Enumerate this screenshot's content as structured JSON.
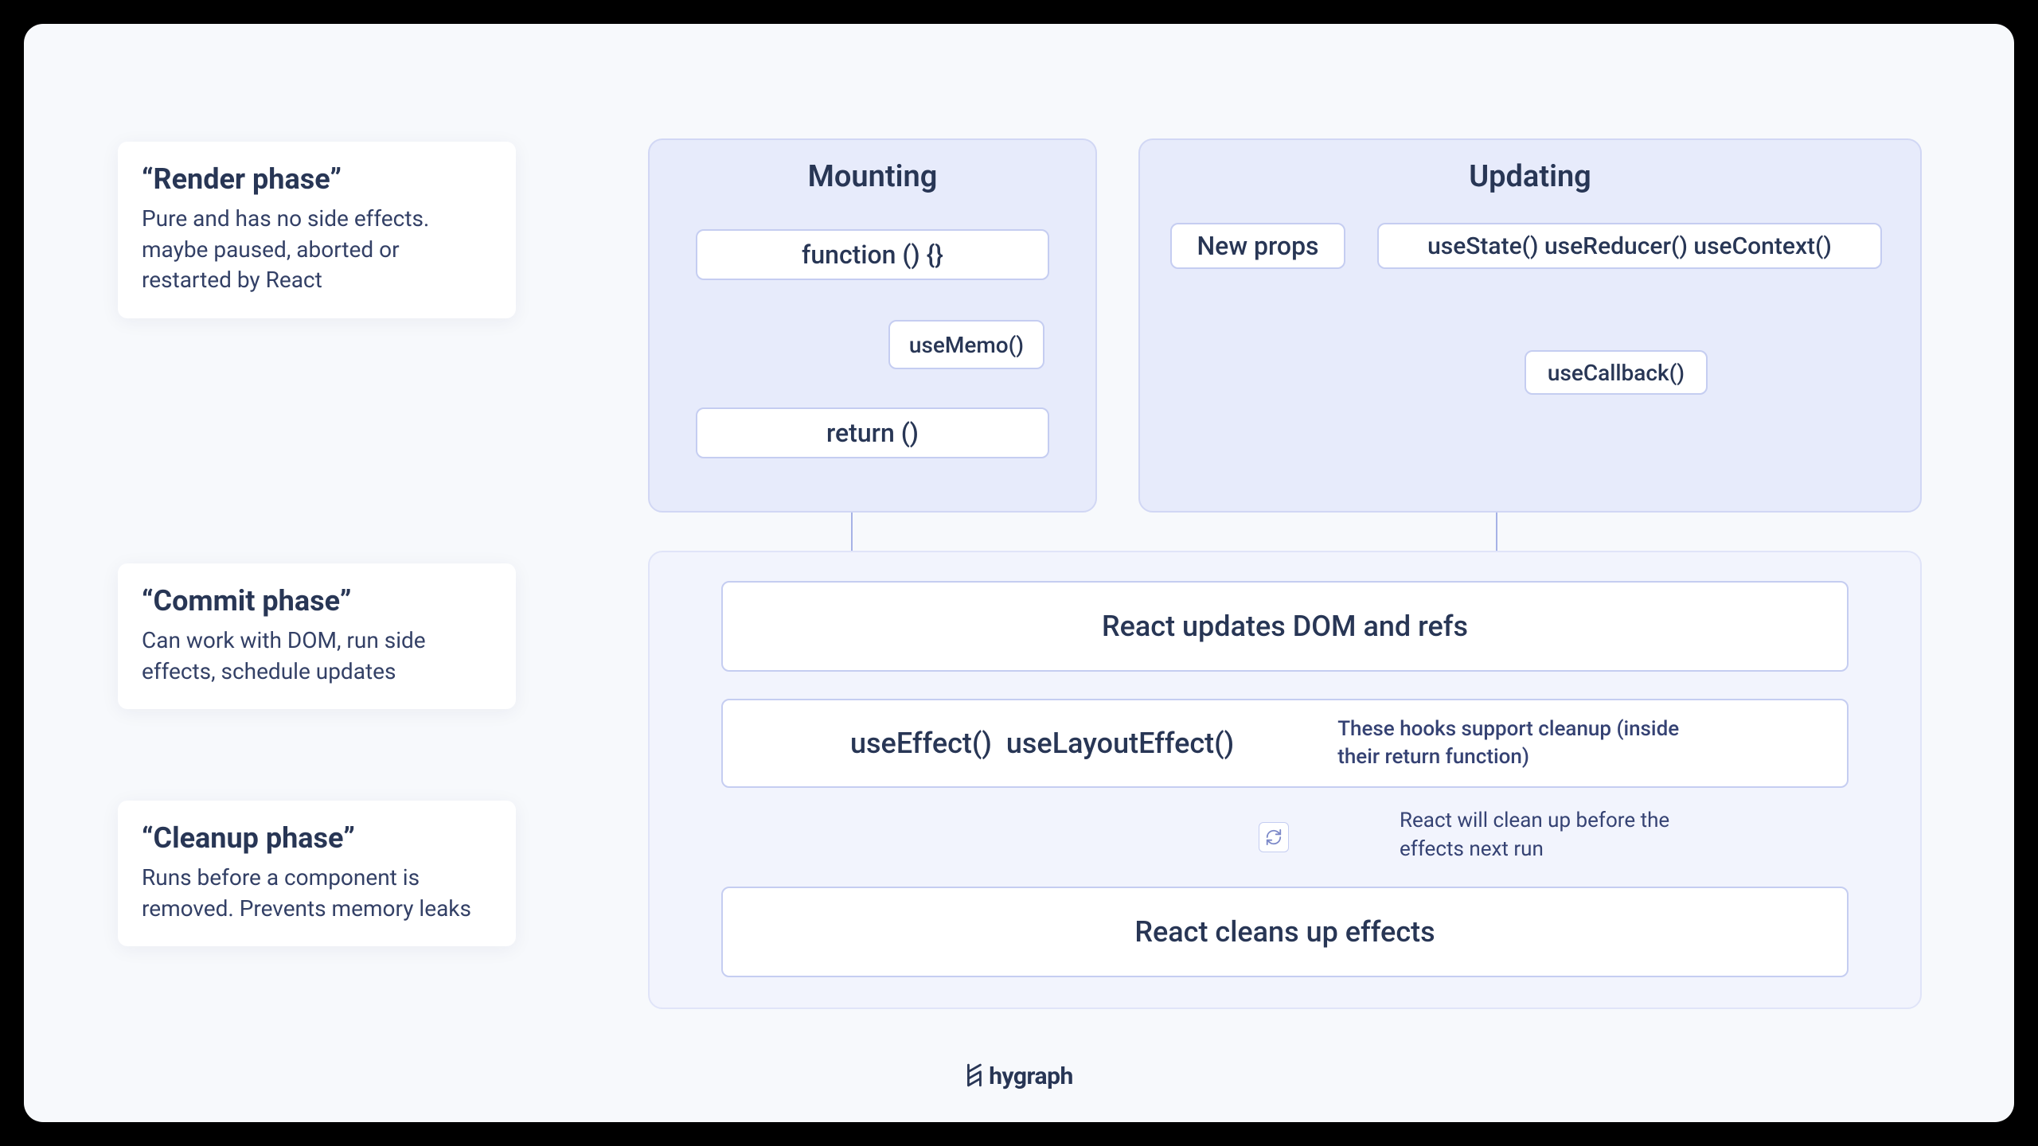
{
  "phases": {
    "render": {
      "title": "“Render phase”",
      "desc": "Pure and has no side effects. maybe paused, aborted or restarted by React"
    },
    "commit": {
      "title": "“Commit phase”",
      "desc": "Can work with DOM, run side effects, schedule updates"
    },
    "cleanup": {
      "title": "“Cleanup phase”",
      "desc": "Runs before a component is removed. Prevents memory leaks"
    }
  },
  "panels": {
    "mounting": {
      "title": "Mounting"
    },
    "updating": {
      "title": "Updating"
    }
  },
  "nodes": {
    "function": "function () {}",
    "usememo": "useMemo()",
    "return": "return ()",
    "newprops": "New props",
    "hooksrow": "useState() useReducer() useContext()",
    "usecallback": "useCallback()",
    "updatesdom": "React updates DOM and refs",
    "effectrow": "useEffect()  useLayoutEffect()",
    "cleansup": "React cleans up effects"
  },
  "annotations": {
    "cleanup_support": "These hooks support cleanup (inside their return function)",
    "cleanup_before": "React will clean up before the effects next run"
  },
  "brand": "hygraph"
}
